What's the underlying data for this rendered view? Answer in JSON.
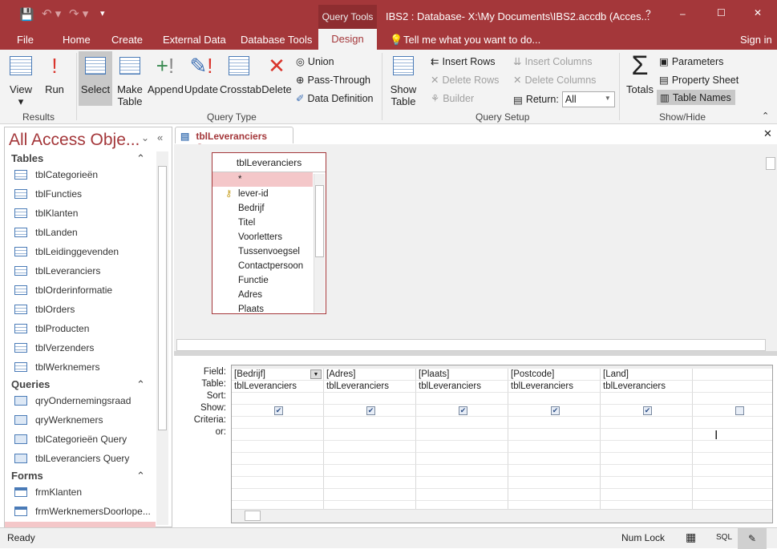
{
  "title": {
    "app_title": "IBS2 : Database- X:\\My Documents\\IBS2.accdb (Acces...",
    "context_tab": "Query Tools",
    "help": "?",
    "minimize": "–",
    "maximize": "☐",
    "close": "✕"
  },
  "tabs": [
    "File",
    "Home",
    "Create",
    "External Data",
    "Database Tools",
    "Design"
  ],
  "tell_me": "Tell me what you want to do...",
  "sign_in": "Sign in",
  "ribbon": {
    "results": {
      "label": "Results",
      "view": "View",
      "run": "Run"
    },
    "query_type": {
      "label": "Query Type",
      "select": "Select",
      "make_table": "Make Table",
      "append": "Append",
      "update": "Update",
      "crosstab": "Crosstab",
      "delete": "Delete",
      "union": "Union",
      "pass_through": "Pass-Through",
      "data_definition": "Data Definition"
    },
    "query_setup": {
      "label": "Query Setup",
      "show_table": "Show Table",
      "insert_rows": "Insert Rows",
      "delete_rows": "Delete Rows",
      "builder": "Builder",
      "insert_columns": "Insert Columns",
      "delete_columns": "Delete Columns",
      "return_label": "Return:",
      "return_value": "All"
    },
    "show_hide": {
      "label": "Show/Hide",
      "totals": "Totals",
      "parameters": "Parameters",
      "property_sheet": "Property Sheet",
      "table_names": "Table Names"
    }
  },
  "nav": {
    "header": "All Access Obje...",
    "groups": [
      {
        "name": "Tables",
        "items": [
          "tblCategorieën",
          "tblFuncties",
          "tblKlanten",
          "tblLanden",
          "tblLeidinggevenden",
          "tblLeveranciers",
          "tblOrderinformatie",
          "tblOrders",
          "tblProducten",
          "tblVerzenders",
          "tblWerknemers"
        ]
      },
      {
        "name": "Queries",
        "items": [
          "qryOndernemingsraad",
          "qryWerknemers",
          "tblCategorieën Query",
          "tblLeveranciers Query"
        ]
      },
      {
        "name": "Forms",
        "items": [
          "frmKlanten",
          "frmWerknemersDoorlope..."
        ]
      }
    ]
  },
  "doc_tab": "tblLeveranciers Query",
  "table_box": {
    "title": "tblLeveranciers",
    "fields": [
      "*",
      "lever-id",
      "Bedrijf",
      "Titel",
      "Voorletters",
      "Tussenvoegsel",
      "Contactpersoon",
      "Functie",
      "Adres",
      "Plaats"
    ]
  },
  "grid": {
    "row_labels": [
      "Field:",
      "Table:",
      "Sort:",
      "Show:",
      "Criteria:",
      "or:"
    ],
    "columns": [
      {
        "field": "[Bedrijf]",
        "table": "tblLeveranciers",
        "show": true
      },
      {
        "field": "[Adres]",
        "table": "tblLeveranciers",
        "show": true
      },
      {
        "field": "[Plaats]",
        "table": "tblLeveranciers",
        "show": true
      },
      {
        "field": "[Postcode]",
        "table": "tblLeveranciers",
        "show": true
      },
      {
        "field": "[Land]",
        "table": "tblLeveranciers",
        "show": true
      },
      {
        "field": "",
        "table": "",
        "show": false
      }
    ]
  },
  "status": {
    "ready": "Ready",
    "num_lock": "Num Lock",
    "sql": "SQL"
  },
  "colors": {
    "accent": "#a4373a",
    "nav_header": "#a4373a"
  }
}
